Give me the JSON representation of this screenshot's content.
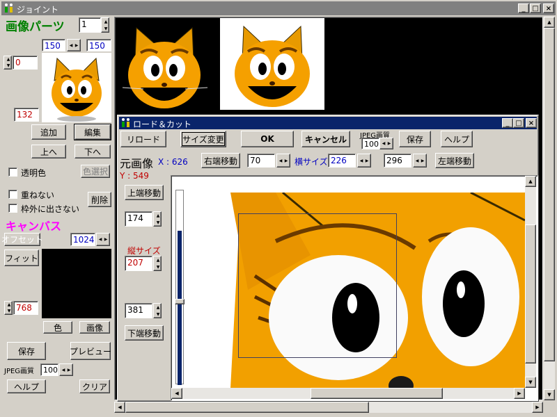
{
  "main_window": {
    "title": "ジョイント",
    "title_icon": "figures-icon",
    "controls": [
      "minimize",
      "maximize",
      "close"
    ]
  },
  "left_panel": {
    "parts_heading": "画像パーツ",
    "part_index": "1",
    "width_value": "150",
    "height_value": "150",
    "x_value": "0",
    "y_value": "132",
    "add_label": "追加",
    "edit_label": "編集",
    "up_label": "上へ",
    "down_label": "下へ",
    "transparent_label": "透明色",
    "color_select_label": "色選択",
    "no_overlap_label": "重ねない",
    "no_outside_label": "枠外に出さない",
    "delete_label": "削除",
    "canvas_heading": "キャンバス",
    "offset_label": "オフセット",
    "canvas_width": "1024",
    "fit_label": "フィット",
    "canvas_height": "768",
    "color_label": "色",
    "image_label": "画像",
    "save_label": "保存",
    "preview_label": "プレビュー",
    "jpeg_quality_label": "JPEG画質",
    "jpeg_quality_value": "100",
    "help_label": "ヘルプ",
    "clear_label": "クリア"
  },
  "dialog": {
    "title": "ロード＆カット",
    "title_icon": "figures-icon",
    "reload_label": "リロード",
    "resize_label": "サイズ変更",
    "ok_label": "OK",
    "cancel_label": "キャンセル",
    "jpeg_quality_label": "JPEG画質",
    "jpeg_quality_value": "100",
    "save_label": "保存",
    "help_label": "ヘルプ",
    "source_label": "元画像",
    "x_readout": "X : 626",
    "y_readout": "Y : 549",
    "right_move_label": "右端移動",
    "right_value": "70",
    "width_label": "横サイズ",
    "width_value": "226",
    "left_value": "296",
    "left_move_label": "左端移動",
    "top_move_label": "上端移動",
    "top_value": "174",
    "height_label": "縦サイズ",
    "height_value": "207",
    "bottom_value": "381",
    "bottom_move_label": "下端移動"
  },
  "colors": {
    "titlebar_active": "#0a246a",
    "titlebar_inactive": "#808080",
    "face_bg": "#d4d0c8",
    "heading_green": "#008000",
    "heading_magenta": "#ff00ff",
    "label_blue": "#0000c0",
    "label_red": "#c00000",
    "cat_orange": "#f5a000"
  }
}
